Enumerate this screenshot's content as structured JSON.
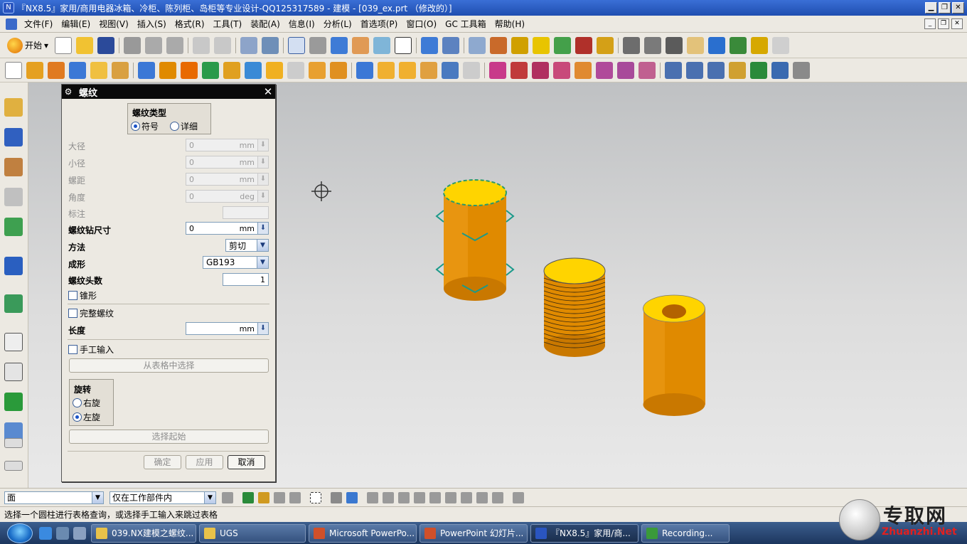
{
  "window": {
    "title": "『NX8.5』家用/商用电器冰箱、冷柜、陈列柜、岛柜等专业设计-QQ125317589 - 建模 - [039_ex.prt （修改的）]",
    "app_icon": "nx-logo-icon"
  },
  "menu": [
    "文件(F)",
    "编辑(E)",
    "视图(V)",
    "插入(S)",
    "格式(R)",
    "工具(T)",
    "装配(A)",
    "信息(I)",
    "分析(L)",
    "首选项(P)",
    "窗口(O)",
    "GC 工具箱",
    "帮助(H)"
  ],
  "toolbar": {
    "start_label": "开始"
  },
  "dialog": {
    "title": "螺纹",
    "thread_type_label": "螺纹类型",
    "type_options": [
      "符号",
      "详细"
    ],
    "type_selected": "符号",
    "major_dia": {
      "label": "大径",
      "value": "0",
      "unit": "mm"
    },
    "minor_dia": {
      "label": "小径",
      "value": "0",
      "unit": "mm"
    },
    "pitch": {
      "label": "螺距",
      "value": "0",
      "unit": "mm"
    },
    "angle": {
      "label": "角度",
      "value": "0",
      "unit": "deg"
    },
    "callout_label": "标注",
    "tap_drill": {
      "label": "螺纹钻尺寸",
      "value": "0",
      "unit": "mm"
    },
    "method": {
      "label": "方法",
      "value": "剪切"
    },
    "form": {
      "label": "成形",
      "value": "GB193"
    },
    "starts": {
      "label": "螺纹头数",
      "value": "1"
    },
    "tapered_label": "锥形",
    "full_thread_label": "完整螺纹",
    "length": {
      "label": "长度",
      "value": "",
      "unit": "mm"
    },
    "manual_input_label": "手工输入",
    "choose_from_table": "从表格中选择",
    "rotation": {
      "label": "旋转",
      "options": [
        "右旋",
        "左旋"
      ],
      "selected": "左旋"
    },
    "select_start": "选择起始",
    "ok": "确定",
    "apply": "应用",
    "cancel": "取消"
  },
  "bottom": {
    "filter_value": "面",
    "scope_value": "仅在工作部件内"
  },
  "status_text": "选择一个圆柱进行表格查询，或选择手工输入来跳过表格",
  "taskbar": {
    "items": [
      "039.NX建模之螺纹...",
      "UGS",
      "Microsoft PowerPo...",
      "PowerPoint 幻灯片...",
      "『NX8.5』家用/商...",
      "Recording..."
    ],
    "active": 4
  },
  "watermark": {
    "text": "专取网",
    "url": "Zhuanzhi.Net"
  },
  "colors": {
    "title_bar": "#1f4eb0",
    "part_orange": "#e08a00",
    "face_yellow": "#ffd400",
    "dialog_bg": "#ece9e2"
  }
}
